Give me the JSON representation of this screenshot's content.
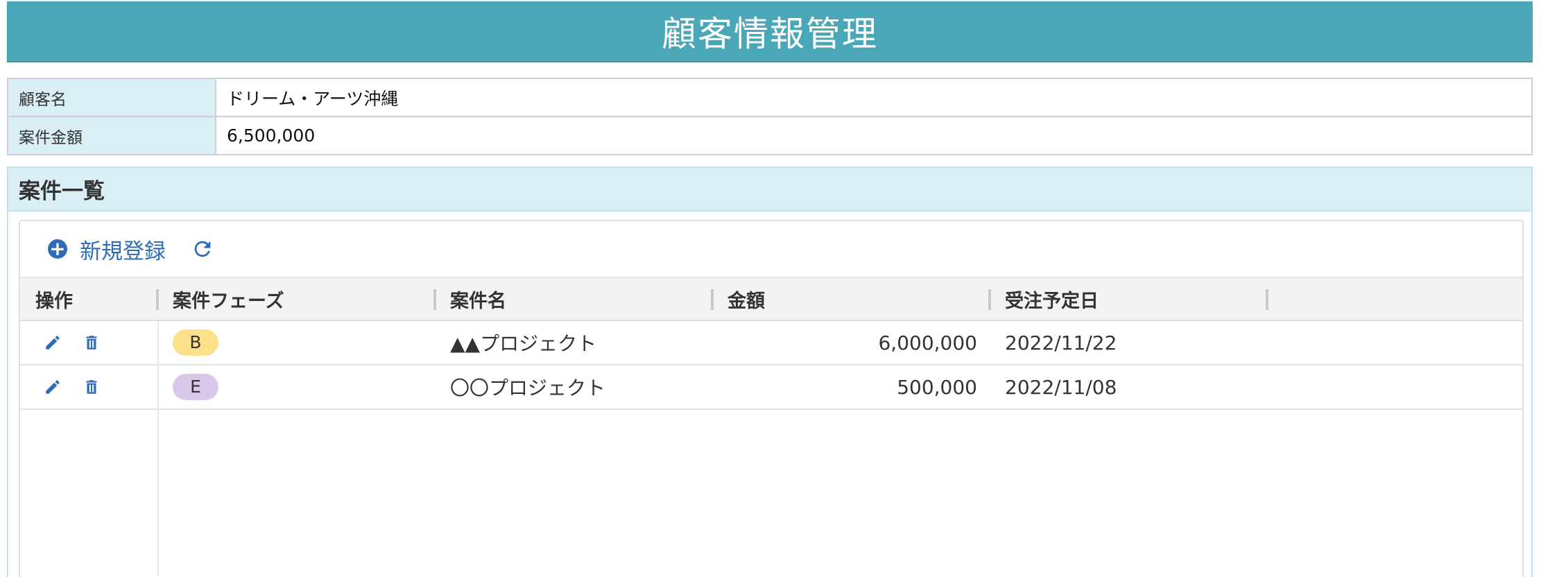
{
  "page": {
    "title": "顧客情報管理"
  },
  "info": {
    "rows": [
      {
        "label": "顧客名",
        "value": "ドリーム・アーツ沖縄"
      },
      {
        "label": "案件金額",
        "value": "6,500,000"
      }
    ]
  },
  "projects": {
    "section_title": "案件一覧",
    "toolbar": {
      "new_label": "新規登録",
      "new_icon": "plus-circle-icon",
      "refresh_icon": "refresh-icon"
    },
    "columns": [
      "操作",
      "案件フェーズ",
      "案件名",
      "金額",
      "受注予定日"
    ],
    "rows": [
      {
        "phase": "B",
        "phase_color": "#fde08a",
        "name": "▲▲プロジェクト",
        "amount": "6,000,000",
        "date": "2022/11/22"
      },
      {
        "phase": "E",
        "phase_color": "#d8c7e8",
        "name": "〇〇プロジェクト",
        "amount": "500,000",
        "date": "2022/11/08"
      }
    ]
  },
  "colors": {
    "title_bar": "#4aa7b8",
    "label_bg": "#d9eff5",
    "accent": "#2e6cb8"
  }
}
